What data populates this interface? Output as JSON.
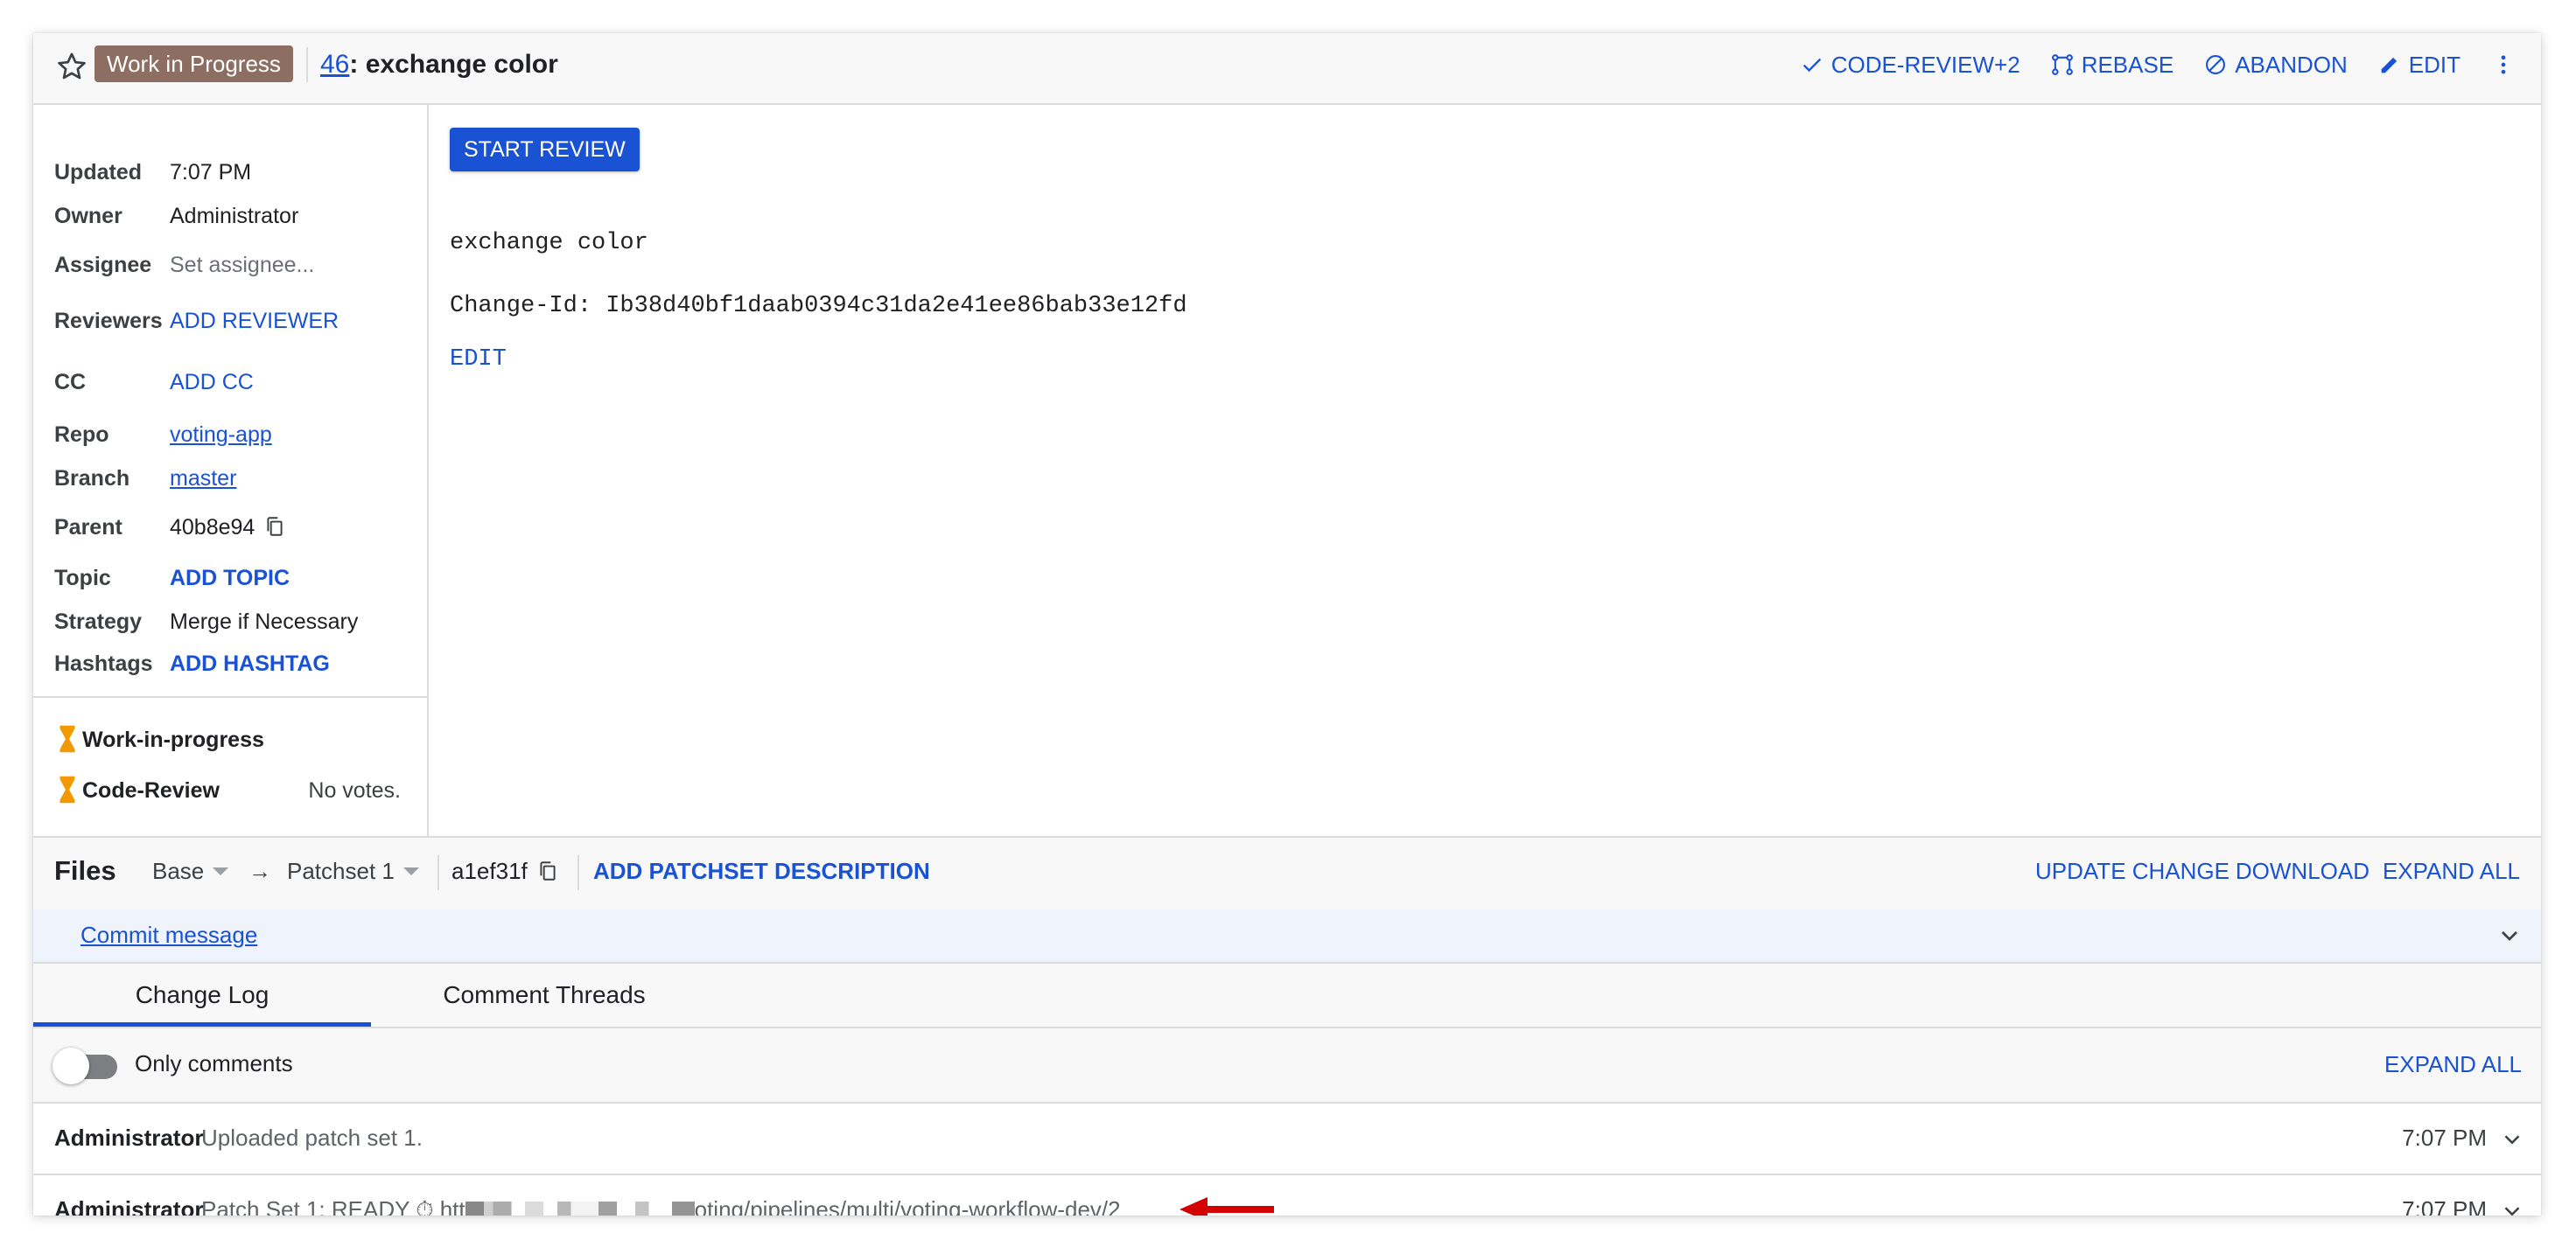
{
  "header": {
    "wip_badge": "Work in Progress",
    "change_number": "46",
    "change_title": ": exchange color",
    "actions": {
      "code_review": "CODE-REVIEW+2",
      "rebase": "REBASE",
      "abandon": "ABANDON",
      "edit": "EDIT"
    }
  },
  "meta": {
    "updated": {
      "label": "Updated",
      "value": "7:07 PM"
    },
    "owner": {
      "label": "Owner",
      "value": "Administrator"
    },
    "assignee": {
      "label": "Assignee",
      "value": "Set assignee..."
    },
    "reviewers": {
      "label": "Reviewers",
      "value": "ADD REVIEWER"
    },
    "cc": {
      "label": "CC",
      "value": "ADD CC"
    },
    "repo": {
      "label": "Repo",
      "value": "voting-app"
    },
    "branch": {
      "label": "Branch",
      "value": "master"
    },
    "parent": {
      "label": "Parent",
      "value": "40b8e94"
    },
    "topic": {
      "label": "Topic",
      "value": "ADD TOPIC"
    },
    "strategy": {
      "label": "Strategy",
      "value": "Merge if Necessary"
    },
    "hashtags": {
      "label": "Hashtags",
      "value": "ADD HASHTAG"
    }
  },
  "labels": {
    "wip": "Work-in-progress",
    "code_review": "Code-Review",
    "no_votes": "No votes."
  },
  "commit": {
    "start_review": "START REVIEW",
    "subject": "exchange color",
    "change_id": "Change-Id: Ib38d40bf1daab0394c31da2e41ee86bab33e12fd",
    "edit": "EDIT"
  },
  "files_bar": {
    "title": "Files",
    "base": "Base",
    "arrow": "→",
    "patchset": "Patchset 1",
    "commit_sha": "a1ef31f",
    "add_description": "ADD PATCHSET DESCRIPTION",
    "update_change": "UPDATE CHANGE",
    "download": "DOWNLOAD",
    "expand_all": "EXPAND ALL"
  },
  "commit_message_link": "Commit message",
  "tabs": [
    {
      "label": "Change Log",
      "active": true
    },
    {
      "label": "Comment Threads",
      "active": false
    }
  ],
  "toggle": {
    "label": "Only comments",
    "on": false
  },
  "expand_all_messages": "EXPAND ALL",
  "messages": [
    {
      "author": "Administrator",
      "text": "Uploaded patch set 1.",
      "time": "7:07 PM"
    },
    {
      "author": "Administrator",
      "text_prefix": "Patch Set 1: READY ⏱ htt",
      "text_suffix": "oting/pipelines/multi/voting-workflow-dev/2",
      "time": "7:07 PM"
    }
  ],
  "colors": {
    "accent": "#1a52d4",
    "wip_badge": "#8d6e63",
    "hourglass": "#f29900",
    "annotation_arrow": "#d50000"
  }
}
